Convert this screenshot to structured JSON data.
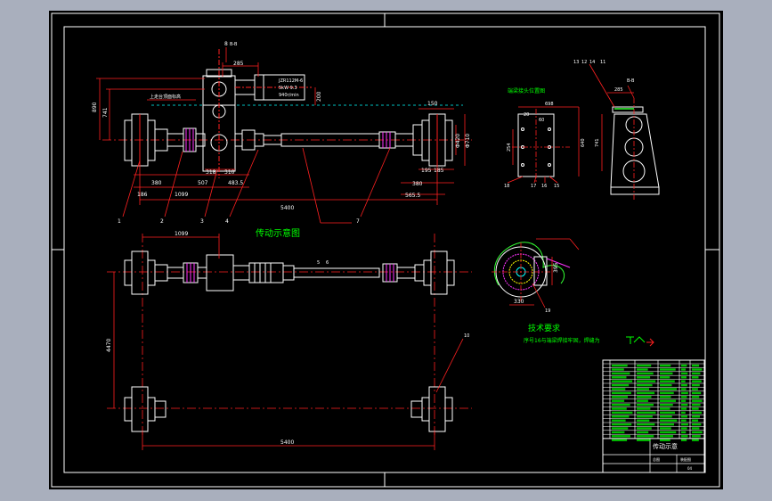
{
  "colors": {
    "background": "#a9afbd",
    "canvas": "#000000",
    "frame": "#ffffff",
    "geometry": "#ffffff",
    "dimension": "#ff2020",
    "centerline": "#ff2020",
    "annotation": "#00ff00",
    "accent": "#ff33ff",
    "highlight": "#00ffff",
    "lever": "#33ff33"
  },
  "elevation_view": {
    "title": "传动示意图",
    "section_label": "B-B",
    "motor_spec_lines": [
      "JZR112M-6",
      "5kW 9.3",
      "940r/min"
    ],
    "note_small": "上走台顶面标高",
    "dims": {
      "top": "285",
      "left_height_outer": "890",
      "left_height_inner": "741",
      "right_height": "200",
      "below_left": [
        "186",
        "380",
        "1099",
        "507",
        "483.5"
      ],
      "below_center": [
        "318",
        "310"
      ],
      "right_end": "150",
      "right_diameters": [
        "Φ420",
        "Φ710"
      ],
      "below_right": [
        "195",
        "185",
        "380",
        "565.5"
      ],
      "total_span": "5400"
    },
    "callouts": [
      "1",
      "2",
      "3",
      "4",
      "7",
      "8"
    ]
  },
  "plan_view": {
    "dims": {
      "top": "1099",
      "gauge": "4470",
      "bottom": "5400"
    },
    "callouts": [
      "5",
      "6",
      "10"
    ]
  },
  "detail_a": {
    "title": "端梁接头位置图",
    "dims": [
      "20",
      "60",
      "698",
      "254",
      "640"
    ],
    "callouts": [
      "18",
      "17",
      "16",
      "15"
    ]
  },
  "side_view": {
    "section_label": "B-B",
    "dims": [
      "285",
      "741"
    ],
    "callouts": [
      "13",
      "12",
      "14",
      "11"
    ]
  },
  "detail_c": {
    "dims": [
      "330",
      "395"
    ],
    "callouts": [
      "19"
    ]
  },
  "technical_requirements": {
    "title": "技术要求",
    "text": "序号16与端梁焊接牢固，焊缝为"
  },
  "title_block": {
    "drawing_name": "传动示意",
    "small_labels": [
      "装配图",
      "总图"
    ],
    "bottom_code": "04"
  }
}
